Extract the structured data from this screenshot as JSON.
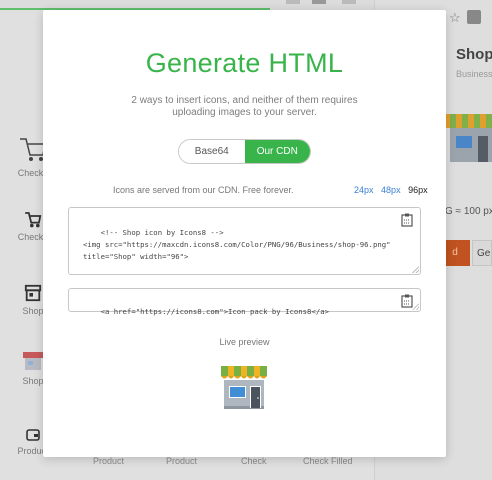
{
  "background": {
    "left_items": [
      {
        "label": "Checko",
        "icon": "shopping-cart-icon"
      },
      {
        "label": "Checko",
        "icon": "shopping-cart-icon"
      },
      {
        "label": "Shop",
        "icon": "shop-icon"
      },
      {
        "label": "Shop",
        "icon": "shop-icon"
      },
      {
        "label": "Product",
        "icon": "wallet-icon"
      }
    ],
    "bottom_labels": [
      "Product",
      "Product",
      "Check",
      "Check Filled"
    ],
    "right_panel": {
      "title": "Shop",
      "subtitle": "Business",
      "size_text": "G ≈ 100 px",
      "orange_button": "d",
      "secondary_button": "Ge"
    }
  },
  "modal": {
    "title": "Generate HTML",
    "subtitle": "2 ways to insert icons, and neither of them requires uploading images to your server.",
    "tabs": [
      {
        "label": "Base64",
        "active": false
      },
      {
        "label": "Our CDN",
        "active": true
      }
    ],
    "cdn_info": "Icons are served from our CDN. Free forever.",
    "sizes": [
      {
        "label": "24px",
        "current": false
      },
      {
        "label": "48px",
        "current": false
      },
      {
        "label": "96px",
        "current": true
      }
    ],
    "code_snippet": "<!-- Shop icon by Icons8 -->\n<img src=\"https://maxcdn.icons8.com/Color/PNG/96/Business/shop-96.png\"\ntitle=\"Shop\" width=\"96\">",
    "link_snippet": "<a href=\"https://icons8.com\">Icon pack by Icons8</a>",
    "live_preview_label": "Live preview",
    "accent_color": "#38b44a"
  }
}
